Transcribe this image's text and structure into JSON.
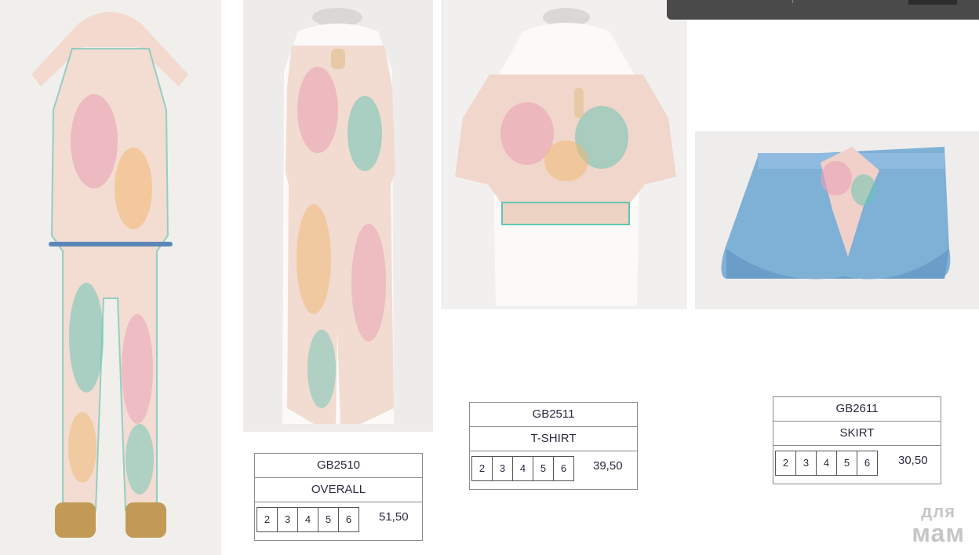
{
  "products": [
    {
      "code": "GB2510",
      "name": "OVERALL",
      "sizes": [
        "2",
        "3",
        "4",
        "5",
        "6"
      ],
      "price": "51,50"
    },
    {
      "code": "GB2511",
      "name": "T-SHIRT",
      "sizes": [
        "2",
        "3",
        "4",
        "5",
        "6"
      ],
      "price": "39,50"
    },
    {
      "code": "GB2611",
      "name": "SKIRT",
      "sizes": [
        "2",
        "3",
        "4",
        "5",
        "6"
      ],
      "price": "30,50"
    }
  ],
  "watermark": {
    "line1": "для",
    "line2": "мам"
  },
  "colors": {
    "paisley_pink": "#e8a7b4",
    "paisley_teal": "#57c3b2",
    "denim": "#7fb0d6",
    "border": "#8c8c8c"
  }
}
